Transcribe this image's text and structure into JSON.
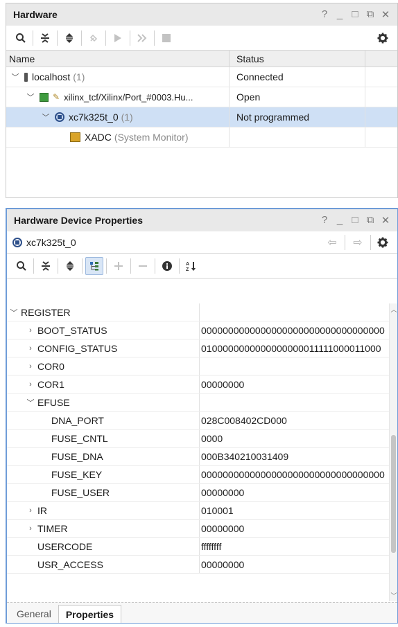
{
  "hardware": {
    "title": "Hardware",
    "window_buttons": [
      "?",
      "_",
      "□",
      "⧉",
      "✕"
    ],
    "toolbar": {
      "icons": [
        "search-icon",
        "collapse-all-icon",
        "expand-all-icon",
        "auto-connect-icon",
        "run-icon",
        "skip-icon",
        "stop-icon",
        "settings-icon"
      ]
    },
    "columns": {
      "name": "Name",
      "status": "Status"
    },
    "tree": [
      {
        "label": "localhost",
        "count": "(1)",
        "status": "Connected"
      },
      {
        "label": "xilinx_tcf/Xilinx/Port_#0003.Hu...",
        "status": "Open"
      },
      {
        "label": "xc7k325t_0",
        "count": "(1)",
        "status": "Not programmed"
      },
      {
        "label": "XADC",
        "sub": "(System Monitor)",
        "status": ""
      }
    ]
  },
  "device_properties": {
    "title": "Hardware Device Properties",
    "window_buttons": [
      "?",
      "_",
      "□",
      "⧉",
      "✕"
    ],
    "device_name": "xc7k325t_0",
    "toolbar": {
      "icons": [
        "search-icon",
        "collapse-all-icon",
        "expand-all-icon",
        "group-icon",
        "add-icon",
        "remove-icon",
        "info-icon",
        "sort-icon"
      ]
    },
    "rows": [
      {
        "key": "REGISTER",
        "value": ""
      },
      {
        "key": "BOOT_STATUS",
        "value": "0000000000000000000000000000000000"
      },
      {
        "key": "CONFIG_STATUS",
        "value": "0100000000000000000011111000011000"
      },
      {
        "key": "COR0",
        "value": ""
      },
      {
        "key": "COR1",
        "value": "00000000"
      },
      {
        "key": "EFUSE",
        "value": ""
      },
      {
        "key": "DNA_PORT",
        "value": "028C008402CD000"
      },
      {
        "key": "FUSE_CNTL",
        "value": "0000"
      },
      {
        "key": "FUSE_DNA",
        "value": "000B340210031409"
      },
      {
        "key": "FUSE_KEY",
        "value": "0000000000000000000000000000000000"
      },
      {
        "key": "FUSE_USER",
        "value": "00000000"
      },
      {
        "key": "IR",
        "value": "010001"
      },
      {
        "key": "TIMER",
        "value": "00000000"
      },
      {
        "key": "USERCODE",
        "value": "ffffffff"
      },
      {
        "key": "USR_ACCESS",
        "value": "00000000"
      }
    ],
    "tabs": {
      "general": "General",
      "properties": "Properties"
    }
  },
  "colors": {
    "selection": "#cfe0f5",
    "accent_border": "#6f9cd8"
  }
}
